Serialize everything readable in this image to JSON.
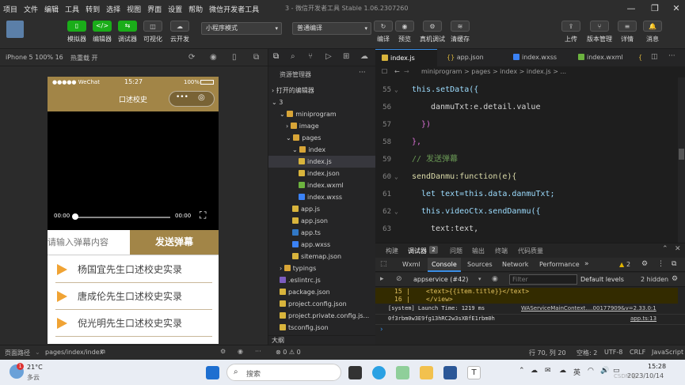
{
  "menubar": {
    "items": [
      "项目",
      "文件",
      "编辑",
      "工具",
      "转到",
      "选择",
      "视图",
      "界面",
      "设置",
      "帮助",
      "微信开发者工具"
    ],
    "title": "3 - 微信开发者工具 Stable 1.06.2307260"
  },
  "toolbar": {
    "left_buttons": [
      {
        "label": "模拟器",
        "icon": "phone-icon"
      },
      {
        "label": "编辑器",
        "icon": "code-icon"
      },
      {
        "label": "调试器",
        "icon": "debug-icon"
      },
      {
        "label": "可视化",
        "icon": "visual-icon"
      },
      {
        "label": "云开发",
        "icon": "cloud-icon"
      }
    ],
    "mode_select": "小程序模式",
    "compile_select": "普通编译",
    "mid_buttons": [
      {
        "label": "编译",
        "icon": "refresh-icon"
      },
      {
        "label": "预览",
        "icon": "eye-icon"
      },
      {
        "label": "真机调试",
        "icon": "bug-icon"
      },
      {
        "label": "清缓存",
        "icon": "layers-icon"
      }
    ],
    "right_buttons": [
      {
        "label": "上传",
        "icon": "upload-icon"
      },
      {
        "label": "版本管理",
        "icon": "branch-icon"
      },
      {
        "label": "详情",
        "icon": "menu-icon"
      },
      {
        "label": "消息",
        "icon": "bell-icon"
      }
    ]
  },
  "simulator": {
    "device": "iPhone 5 100% 16",
    "hotreload": "热重载 开",
    "status_carrier": "●●●●● WeChat",
    "status_time": "15:27",
    "status_battery": "100%",
    "nav_title": "口述校史",
    "video_time_left": "00:00",
    "video_time_right": "00:00",
    "input_placeholder": "请输入弹幕内容",
    "send_button": "发送弹幕",
    "list": [
      "杨国宜先生口述校史实录",
      "唐成伦先生口述校史实录",
      "倪光明先生口述校史实录"
    ]
  },
  "explorer": {
    "title": "资源管理器",
    "open_editors": "打开的编辑器",
    "project": "3",
    "tree": [
      {
        "name": "miniprogram",
        "depth": 1,
        "kind": "folder-open"
      },
      {
        "name": "image",
        "depth": 2,
        "kind": "folder"
      },
      {
        "name": "pages",
        "depth": 2,
        "kind": "folder-open"
      },
      {
        "name": "index",
        "depth": 3,
        "kind": "folder-open"
      },
      {
        "name": "index.js",
        "depth": 4,
        "kind": "js",
        "active": true
      },
      {
        "name": "index.json",
        "depth": 4,
        "kind": "json"
      },
      {
        "name": "index.wxml",
        "depth": 4,
        "kind": "wxml"
      },
      {
        "name": "index.wxss",
        "depth": 4,
        "kind": "wxss"
      },
      {
        "name": "app.js",
        "depth": 3,
        "kind": "js"
      },
      {
        "name": "app.json",
        "depth": 3,
        "kind": "json"
      },
      {
        "name": "app.ts",
        "depth": 3,
        "kind": "ts"
      },
      {
        "name": "app.wxss",
        "depth": 3,
        "kind": "wxss"
      },
      {
        "name": "sitemap.json",
        "depth": 3,
        "kind": "json"
      },
      {
        "name": "typings",
        "depth": 1,
        "kind": "folder"
      },
      {
        "name": ".eslintrc.js",
        "depth": 1,
        "kind": "eslint"
      },
      {
        "name": "package.json",
        "depth": 1,
        "kind": "json"
      },
      {
        "name": "project.config.json",
        "depth": 1,
        "kind": "json"
      },
      {
        "name": "project.private.config.js...",
        "depth": 1,
        "kind": "json"
      },
      {
        "name": "tsconfig.json",
        "depth": 1,
        "kind": "json"
      }
    ],
    "outline": "大纲",
    "status_errors": "⊗ 0 ⚠ 0"
  },
  "editor": {
    "tabs": [
      "index.js",
      "app.json",
      "index.wxss",
      "index.wxml",
      "{"
    ],
    "breadcrumb": "miniprogram > pages > index > index.js > ...",
    "lines": [
      {
        "n": "55",
        "code": "this.setData({"
      },
      {
        "n": "56",
        "code": "danmuTxt:e.detail.value"
      },
      {
        "n": "57",
        "code": "})"
      },
      {
        "n": "58",
        "code": "},"
      },
      {
        "n": "59",
        "code": "// 发送弹幕"
      },
      {
        "n": "60",
        "code": "sendDanmu:function(e){"
      },
      {
        "n": "61",
        "code": "let text=this.data.danmuTxt;"
      },
      {
        "n": "62",
        "code": "this.videoCtx.sendDanmu({"
      },
      {
        "n": "63",
        "code": "text:text,"
      }
    ]
  },
  "devtools": {
    "top_tabs": [
      "构建",
      "调试器",
      "问题",
      "输出",
      "终端",
      "代码质量"
    ],
    "debugger_badge": "2",
    "panel_tabs": [
      "Wxml",
      "Console",
      "Sources",
      "Network",
      "Performance"
    ],
    "warn_count": "2",
    "context": "appservice (#42)",
    "filter_placeholder": "Filter",
    "levels": "Default levels",
    "hidden": "2 hidden",
    "code_lines": [
      {
        "n": "15",
        "code": "<text>{{item.title}}</text>"
      },
      {
        "n": "16",
        "code": "</view>"
      }
    ],
    "log1_text": "[system] Launch Time: 1219 ms",
    "log1_src": "WAServiceMainContext.…00177909&v=2.33.0:1",
    "log2_text": "0f3rbm0w3E9fg13hRC2w3sXBfE1rbm0h",
    "log2_src": "app.ts:13"
  },
  "statusbar": {
    "page_path_label": "页面路径",
    "page_path": "pages/index/index",
    "cursor": "行 70, 列 20",
    "spaces": "空格: 2",
    "encoding": "UTF-8",
    "eol": "CRLF",
    "lang": "JavaScript"
  },
  "taskbar": {
    "weather_badge": "1",
    "temp": "21°C",
    "weather": "多云",
    "search": "搜索",
    "ime": "英",
    "time": "15:28",
    "date": "2023/10/14",
    "watermark": "CSDN @..."
  }
}
